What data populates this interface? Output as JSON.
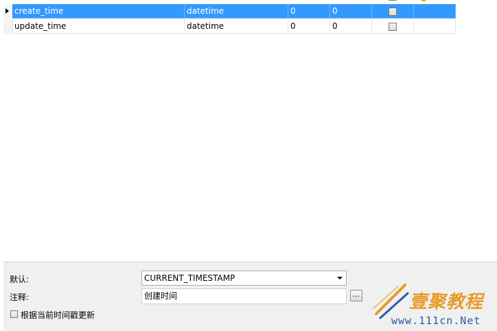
{
  "table": {
    "rows": [
      {
        "name": "create_time",
        "type": "datetime",
        "length": "0",
        "decimals": "0",
        "selected": true
      },
      {
        "name": "update_time",
        "type": "datetime",
        "length": "0",
        "decimals": "0",
        "selected": false
      }
    ]
  },
  "props": {
    "default_label": "默认:",
    "default_value": "CURRENT_TIMESTAMP",
    "comment_label": "注释:",
    "comment_value": "创建时间",
    "ellipsis_label": "...",
    "on_update_label": "根据当前时间戳更新"
  },
  "watermark": {
    "brand": "壹聚教程",
    "url": "www.111cn.Net"
  },
  "colors": {
    "selection": "#3399ff",
    "panel": "#f0f0f0",
    "brand": "#e79a2a",
    "url": "#2a5aa8"
  }
}
